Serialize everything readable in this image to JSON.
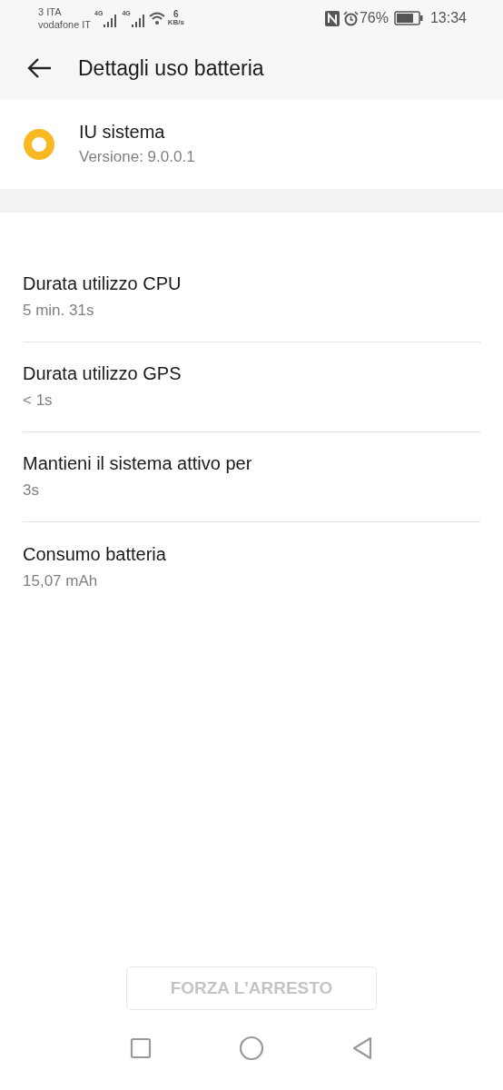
{
  "status_bar": {
    "carrier_1": "3 ITA",
    "carrier_2": "vodafone IT",
    "signal_1_label": "4G",
    "signal_2_label": "4G",
    "speed_value": "6",
    "speed_unit": "KB/s",
    "battery_percent": "76%",
    "time": "13:34"
  },
  "header": {
    "title": "Dettagli uso batteria"
  },
  "app": {
    "name": "IU sistema",
    "version": "Versione: 9.0.0.1"
  },
  "stats": [
    {
      "label": "Durata utilizzo CPU",
      "value": "5 min. 31s"
    },
    {
      "label": "Durata utilizzo GPS",
      "value": "< 1s"
    },
    {
      "label": "Mantieni il sistema attivo per",
      "value": "3s"
    },
    {
      "label": "Consumo batteria",
      "value": "15,07 mAh"
    }
  ],
  "force_stop_button": {
    "label": "FORZA L'ARRESTO",
    "disabled": true
  }
}
